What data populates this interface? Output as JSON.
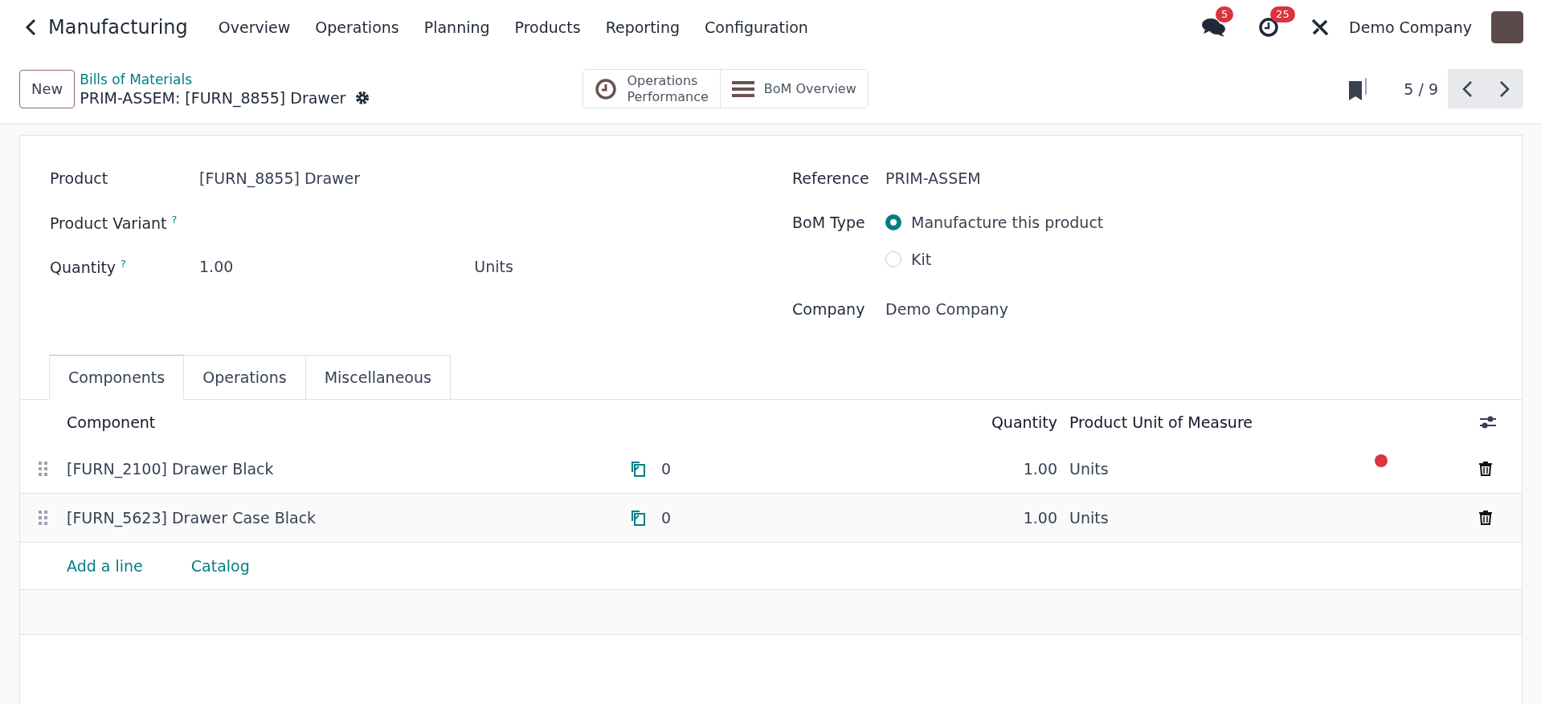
{
  "app": {
    "title": "Manufacturing",
    "menu": [
      "Overview",
      "Operations",
      "Planning",
      "Products",
      "Reporting",
      "Configuration"
    ]
  },
  "systray": {
    "messages_count": "5",
    "activities_count": "25",
    "company": "Demo Company"
  },
  "control_panel": {
    "new_button": "New",
    "breadcrumb": "Bills of Materials",
    "record_title": "PRIM-ASSEM: [FURN_8855] Drawer",
    "pager": "5 / 9",
    "smart_buttons": [
      {
        "kind": "clock",
        "lines": [
          "Operations",
          "Performance"
        ]
      },
      {
        "kind": "bars",
        "lines": [
          "BoM Overview"
        ]
      }
    ]
  },
  "form": {
    "left": [
      {
        "label": "Product",
        "value": "[FURN_8855] Drawer"
      },
      {
        "label": "Product Variant",
        "help": "?"
      },
      {
        "label": "Quantity",
        "help": "?",
        "value": "1.00",
        "unit": "Units"
      }
    ],
    "right": [
      {
        "kind": "text",
        "label": "Reference",
        "value": "PRIM-ASSEM"
      },
      {
        "kind": "radio",
        "label": "BoM Type",
        "options": [
          {
            "label": "Manufacture this product",
            "selected": true
          },
          {
            "label": "Kit",
            "selected": false
          }
        ]
      },
      {
        "kind": "text",
        "label": "Company",
        "value": "Demo Company"
      }
    ]
  },
  "tabs": [
    {
      "label": "Components",
      "selected": true
    },
    {
      "label": "Operations",
      "selected": false
    },
    {
      "label": "Miscellaneous",
      "selected": false
    }
  ],
  "table": {
    "columns": [
      "Component",
      "Quantity",
      "Product Unit of Measure"
    ],
    "rows": [
      {
        "component": "[FURN_2100] Drawer Black",
        "column_2": "0",
        "quantity": "1.00",
        "uom": "Units"
      },
      {
        "component": "[FURN_5623] Drawer Case Black",
        "column_2": "0",
        "quantity": "1.00",
        "uom": "Units"
      }
    ],
    "actions": [
      "Add a line",
      "Catalog"
    ]
  }
}
